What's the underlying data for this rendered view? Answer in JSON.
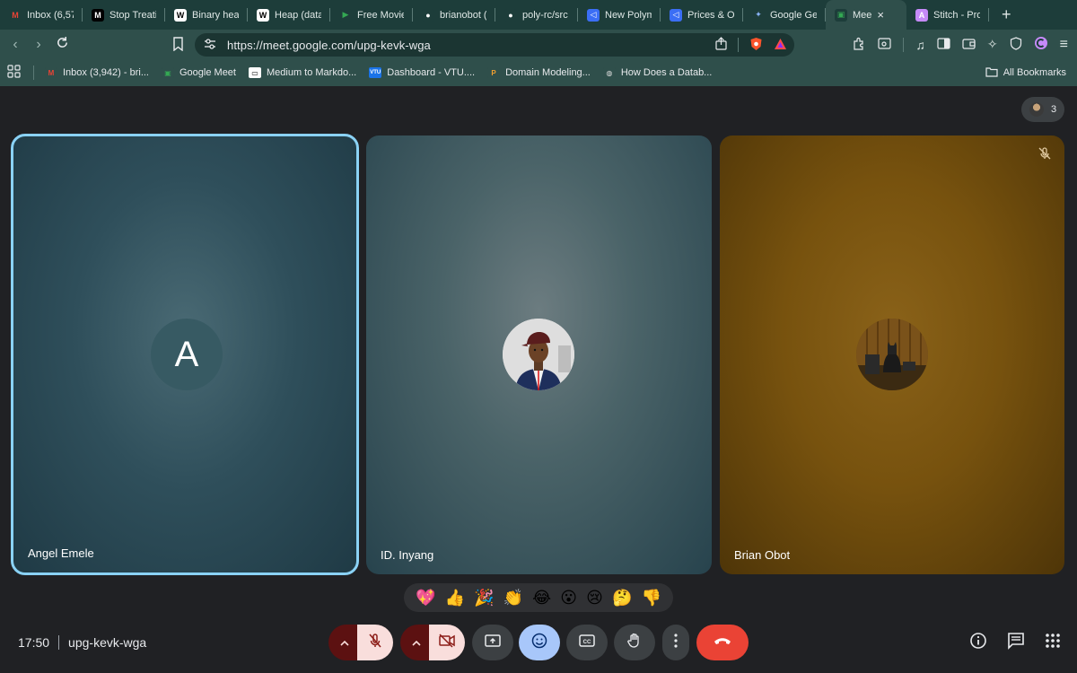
{
  "browser": {
    "tabs": [
      {
        "label": "Inbox (6,57",
        "fav_text": "M",
        "fav_bg": "#1d3d3a",
        "fav_color": "#ea4335"
      },
      {
        "label": "Stop Treati",
        "fav_text": "M",
        "fav_bg": "#000000",
        "fav_color": "#ffffff"
      },
      {
        "label": "Binary heap",
        "fav_text": "W",
        "fav_bg": "#ffffff",
        "fav_color": "#000000"
      },
      {
        "label": "Heap (data",
        "fav_text": "W",
        "fav_bg": "#ffffff",
        "fav_color": "#000000"
      },
      {
        "label": "Free Movie",
        "fav_text": "▶",
        "fav_bg": "#1d3d3a",
        "fav_color": "#34a853"
      },
      {
        "label": "brianobot (",
        "fav_text": "●",
        "fav_bg": "#1d3d3a",
        "fav_color": "#ffffff"
      },
      {
        "label": "poly-rc/src",
        "fav_text": "●",
        "fav_bg": "#1d3d3a",
        "fav_color": "#ffffff"
      },
      {
        "label": "New Polym",
        "fav_text": "◁",
        "fav_bg": "#3b6ef5",
        "fav_color": "#ffffff"
      },
      {
        "label": "Prices & Or",
        "fav_text": "◁",
        "fav_bg": "#3b6ef5",
        "fav_color": "#ffffff"
      },
      {
        "label": "Google Ger",
        "fav_text": "✦",
        "fav_bg": "#1d3d3a",
        "fav_color": "#8ab4f8"
      },
      {
        "label": "Mee",
        "fav_text": "▣",
        "fav_bg": "#1d3d3a",
        "fav_color": "#34a853",
        "active": true
      },
      {
        "label": "Stitch - Pro",
        "fav_text": "A",
        "fav_bg": "#c58af9",
        "fav_color": "#ffffff"
      }
    ],
    "url": "https://meet.google.com/upg-kevk-wga",
    "bookmarks": [
      {
        "label": "Inbox (3,942) - bri...",
        "icon_text": "M",
        "icon_bg": "#2f4f4b",
        "icon_color": "#ea4335"
      },
      {
        "label": "Google Meet",
        "icon_text": "▣",
        "icon_bg": "#2f4f4b",
        "icon_color": "#34a853"
      },
      {
        "label": "Medium to Markdo...",
        "icon_text": "▭",
        "icon_bg": "#ffffff",
        "icon_color": "#000000"
      },
      {
        "label": "Dashboard - VTU....",
        "icon_text": "VTU",
        "icon_bg": "#1a73e8",
        "icon_color": "#ffffff"
      },
      {
        "label": "Domain Modeling...",
        "icon_text": "P",
        "icon_bg": "#2f4f4b",
        "icon_color": "#f0a030"
      },
      {
        "label": "How Does a Datab...",
        "icon_text": "◍",
        "icon_bg": "#2f4f4b",
        "icon_color": "#dddddd"
      }
    ],
    "all_bookmarks": "All Bookmarks"
  },
  "meet": {
    "participant_count": "3",
    "participants": [
      {
        "name": "Angel Emele",
        "avatar_letter": "A"
      },
      {
        "name": "ID. Inyang"
      },
      {
        "name": "Brian Obot"
      }
    ],
    "reactions": [
      "💖",
      "👍",
      "🎉",
      "👏",
      "😂",
      "😮",
      "😢",
      "🤔",
      "👎"
    ],
    "time": "17:50",
    "meeting_code": "upg-kevk-wga",
    "colors": {
      "accent": "#8ad2f5",
      "end_call": "#ea4335",
      "mic_off_bg": "#f9dedc",
      "emoji_btn": "#a8c7fa"
    }
  }
}
